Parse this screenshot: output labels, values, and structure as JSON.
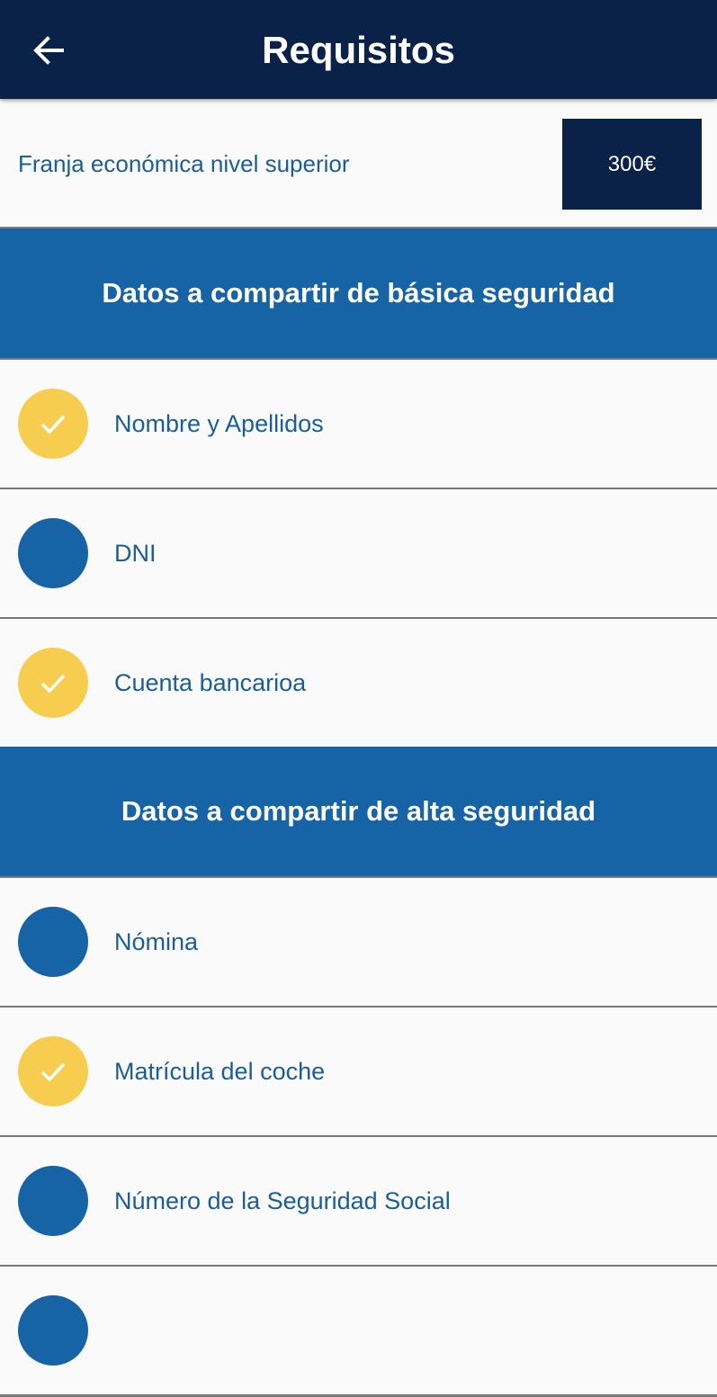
{
  "appbar": {
    "title": "Requisitos",
    "back_icon": "arrow-left-icon"
  },
  "tier": {
    "label": "Franja económica nivel superior",
    "price": "300€"
  },
  "sections": [
    {
      "title": "Datos a compartir de básica seguridad",
      "items": [
        {
          "label": "Nombre y Apellidos",
          "checked": true
        },
        {
          "label": "DNI",
          "checked": false
        },
        {
          "label": "Cuenta bancarioa",
          "checked": true
        }
      ]
    },
    {
      "title": "Datos a compartir de alta seguridad",
      "items": [
        {
          "label": "Nómina",
          "checked": false
        },
        {
          "label": "Matrícula del coche",
          "checked": true
        },
        {
          "label": "Número de la Seguridad Social",
          "checked": false
        },
        {
          "label": "",
          "checked": false
        }
      ]
    }
  ],
  "colors": {
    "appbar_bg": "#0a2148",
    "section_bg": "#1663a6",
    "text_blue": "#1b5e96",
    "checked": "#f7cd50",
    "unchecked": "#1663a6"
  }
}
